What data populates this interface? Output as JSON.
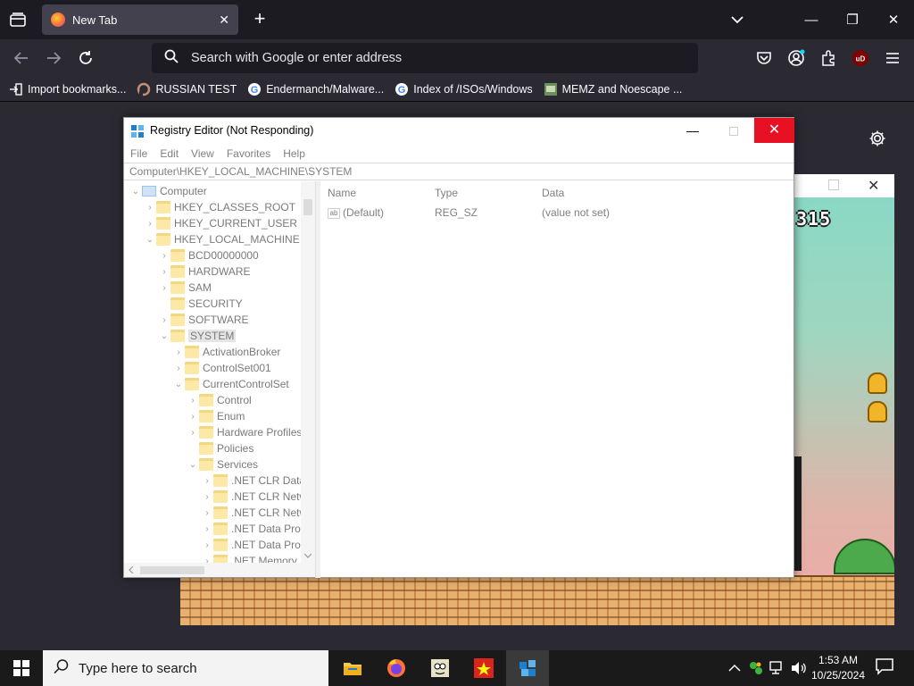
{
  "browser": {
    "tab": {
      "title": "New Tab",
      "close": "✕"
    },
    "new_tab": "+",
    "window_controls": {
      "minimize": "—",
      "maximize": "❐",
      "close": "✕"
    },
    "search": {
      "placeholder": "Search with Google or enter address"
    },
    "bookmarks": [
      {
        "label": "Import bookmarks...",
        "icon": "import-icon"
      },
      {
        "label": "RUSSIAN TEST",
        "icon": "russian-test-favicon"
      },
      {
        "label": "Endermanch/Malware...",
        "icon": "google-favicon"
      },
      {
        "label": "Index of /ISOs/Windows",
        "icon": "google-favicon"
      },
      {
        "label": "MEMZ and Noescape ...",
        "icon": "memz-favicon"
      }
    ]
  },
  "game": {
    "score": "315",
    "close": "✕"
  },
  "regedit": {
    "title": "Registry Editor (Not Responding)",
    "minimize": "—",
    "close": "✕",
    "menu": [
      "File",
      "Edit",
      "View",
      "Favorites",
      "Help"
    ],
    "address": "Computer\\HKEY_LOCAL_MACHINE\\SYSTEM",
    "tree": [
      {
        "label": "Computer",
        "depth": 0,
        "chev": "⌄",
        "icon": "pc"
      },
      {
        "label": "HKEY_CLASSES_ROOT",
        "depth": 1,
        "chev": "›",
        "icon": "folder"
      },
      {
        "label": "HKEY_CURRENT_USER",
        "depth": 1,
        "chev": "›",
        "icon": "folder"
      },
      {
        "label": "HKEY_LOCAL_MACHINE",
        "depth": 1,
        "chev": "⌄",
        "icon": "folder"
      },
      {
        "label": "BCD00000000",
        "depth": 2,
        "chev": "›",
        "icon": "folder"
      },
      {
        "label": "HARDWARE",
        "depth": 2,
        "chev": "›",
        "icon": "folder"
      },
      {
        "label": "SAM",
        "depth": 2,
        "chev": "›",
        "icon": "folder"
      },
      {
        "label": "SECURITY",
        "depth": 2,
        "chev": "",
        "icon": "folder"
      },
      {
        "label": "SOFTWARE",
        "depth": 2,
        "chev": "›",
        "icon": "folder"
      },
      {
        "label": "SYSTEM",
        "depth": 2,
        "chev": "⌄",
        "icon": "folder",
        "selected": true
      },
      {
        "label": "ActivationBroker",
        "depth": 3,
        "chev": "›",
        "icon": "folder"
      },
      {
        "label": "ControlSet001",
        "depth": 3,
        "chev": "›",
        "icon": "folder"
      },
      {
        "label": "CurrentControlSet",
        "depth": 3,
        "chev": "⌄",
        "icon": "folder"
      },
      {
        "label": "Control",
        "depth": 4,
        "chev": "›",
        "icon": "folder"
      },
      {
        "label": "Enum",
        "depth": 4,
        "chev": "›",
        "icon": "folder"
      },
      {
        "label": "Hardware Profiles",
        "depth": 4,
        "chev": "›",
        "icon": "folder"
      },
      {
        "label": "Policies",
        "depth": 4,
        "chev": "",
        "icon": "folder"
      },
      {
        "label": "Services",
        "depth": 4,
        "chev": "⌄",
        "icon": "folder"
      },
      {
        "label": ".NET CLR Data",
        "depth": 5,
        "chev": "›",
        "icon": "folder"
      },
      {
        "label": ".NET CLR Netw",
        "depth": 5,
        "chev": "›",
        "icon": "folder"
      },
      {
        "label": ".NET CLR Netw",
        "depth": 5,
        "chev": "›",
        "icon": "folder"
      },
      {
        "label": ".NET Data Prov",
        "depth": 5,
        "chev": "›",
        "icon": "folder"
      },
      {
        "label": ".NET Data Prov",
        "depth": 5,
        "chev": "›",
        "icon": "folder"
      },
      {
        "label": ".NET Memory",
        "depth": 5,
        "chev": "›",
        "icon": "folder"
      }
    ],
    "columns": {
      "name": "Name",
      "type": "Type",
      "data": "Data"
    },
    "values": [
      {
        "name": "(Default)",
        "type": "REG_SZ",
        "data": "(value not set)"
      }
    ]
  },
  "taskbar": {
    "search_placeholder": "Type here to search",
    "time": "1:53 AM",
    "date": "10/25/2024"
  },
  "colors": {
    "close_red": "#e81123",
    "firefox_orange": "#ff7139",
    "ublock_red": "#800000"
  }
}
